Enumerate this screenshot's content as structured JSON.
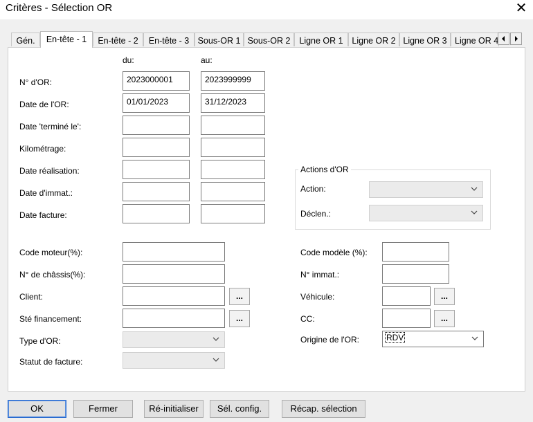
{
  "window": {
    "title": "Critères - Sélection OR",
    "close_glyph": "✕"
  },
  "tabs": [
    {
      "label": "Gén."
    },
    {
      "label": "En-tête - 1"
    },
    {
      "label": "En-tête - 2"
    },
    {
      "label": "En-tête - 3"
    },
    {
      "label": "Sous-OR 1"
    },
    {
      "label": "Sous-OR 2"
    },
    {
      "label": "Ligne OR  1"
    },
    {
      "label": "Ligne OR 2"
    },
    {
      "label": "Ligne OR 3"
    },
    {
      "label": "Ligne OR 4"
    }
  ],
  "range": {
    "du_label": "du:",
    "au_label": "au:",
    "rows": [
      {
        "label": "N° d'OR:",
        "from": "2023000001",
        "to": "2023999999"
      },
      {
        "label": "Date de l'OR:",
        "from": "01/01/2023",
        "to": "31/12/2023"
      },
      {
        "label": "Date 'terminé le':",
        "from": "",
        "to": ""
      },
      {
        "label": "Kilométrage:",
        "from": "",
        "to": ""
      },
      {
        "label": "Date réalisation:",
        "from": "",
        "to": ""
      },
      {
        "label": "Date d'immat.:",
        "from": "",
        "to": ""
      },
      {
        "label": "Date facture:",
        "from": "",
        "to": ""
      }
    ]
  },
  "actions_group": {
    "title": "Actions d'OR",
    "action_label": "Action:",
    "declen_label": "Déclen.:",
    "action_value": "",
    "declen_value": ""
  },
  "left_fields": {
    "code_moteur": {
      "label": "Code moteur(%):",
      "value": ""
    },
    "chassis": {
      "label": "N° de châssis(%):",
      "value": ""
    },
    "client": {
      "label": "Client:",
      "value": ""
    },
    "financement": {
      "label": "Sté financement:",
      "value": ""
    },
    "type_or": {
      "label": "Type d'OR:",
      "value": ""
    },
    "statut_facture": {
      "label": "Statut de facture:",
      "value": ""
    }
  },
  "right_fields": {
    "code_modele": {
      "label": "Code modèle (%):",
      "value": ""
    },
    "immat": {
      "label": "N° immat.:",
      "value": ""
    },
    "vehicule": {
      "label": "Véhicule:",
      "value": ""
    },
    "cc": {
      "label": "CC:",
      "value": ""
    },
    "origine": {
      "label": "Origine de l'OR:",
      "value": "RDV"
    }
  },
  "browse_label": "...",
  "buttons": {
    "ok": "OK",
    "fermer": "Fermer",
    "reinit": "Ré-initialiser",
    "sel_config": "Sél. config.",
    "recap": "Récap. sélection"
  }
}
